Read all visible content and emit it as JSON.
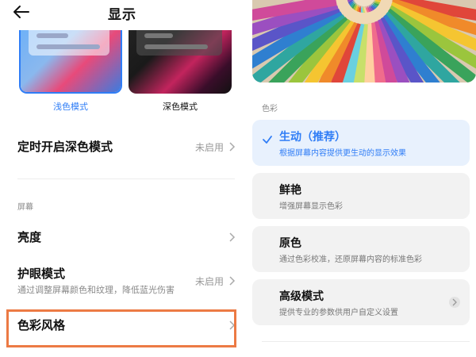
{
  "header": {
    "title": "显示"
  },
  "theme": {
    "light_label": "浅色模式",
    "dark_label": "深色模式"
  },
  "rows": {
    "schedule_dark": {
      "title": "定时开启深色模式",
      "value": "未启用"
    },
    "screen_section": "屏幕",
    "brightness": {
      "title": "亮度"
    },
    "eye_care": {
      "title": "护眼模式",
      "subtitle": "通过调整屏幕颜色和纹理，降低蓝光伤害",
      "value": "未启用"
    },
    "color_style": {
      "title": "色彩风格"
    }
  },
  "color_page": {
    "section_label": "色彩",
    "modes": [
      {
        "title": "生动（推荐）",
        "desc": "根据屏幕内容提供更生动的显示效果",
        "selected": true
      },
      {
        "title": "鲜艳",
        "desc": "增强屏幕显示色彩",
        "selected": false
      },
      {
        "title": "原色",
        "desc": "通过色彩校准，还原屏幕内容的标准色彩",
        "selected": false
      },
      {
        "title": "高级模式",
        "desc": "提供专业的参数供用户自定义设置",
        "selected": false
      }
    ]
  },
  "colors": {
    "accent": "#2f7df6",
    "highlight": "#ec7a44"
  },
  "icons": {
    "back": "arrow-left",
    "chevron": "chevron-right",
    "check": "check-mark"
  }
}
